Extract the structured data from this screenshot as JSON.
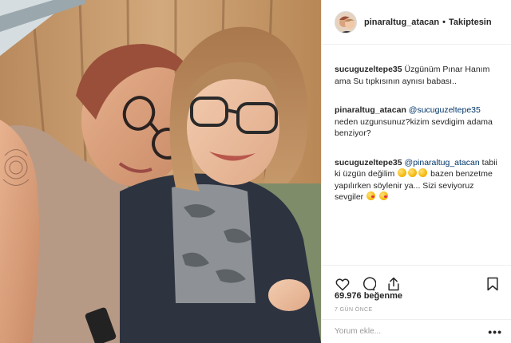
{
  "post": {
    "username": "pinaraltug_atacan",
    "follow_status": "Takiptesin",
    "separator": "•"
  },
  "comments": [
    {
      "user": "sucuguzeltepe35",
      "text": "Üzgünüm Pınar Hanım ama Su tıpkısının aynısı babası.."
    },
    {
      "user": "pinaraltug_atacan",
      "mention": "@sucuguzeltepe35",
      "text": "neden uzgunsunuz?kizim sevdigim adama benziyor?"
    },
    {
      "user": "sucuguzeltepe35",
      "mention": "@pinaraltug_atacan",
      "text_part1": "tabii ki üzgün değilim",
      "text_part2": "bazen benzetme yapılırken söylenir ya... Sizi seviyoruz sevgiler"
    }
  ],
  "actions": {
    "like_icon": "heart-icon",
    "comment_icon": "comment-icon",
    "share_icon": "share-icon",
    "save_icon": "bookmark-icon"
  },
  "likes": "69.976 beğenme",
  "time_ago": "7 GÜN ÖNCE",
  "comment_input": {
    "placeholder": "Yorum ekle..."
  },
  "more_options": "•••",
  "colors": {
    "text": "#262626",
    "mention": "#003569",
    "muted": "#999999",
    "border": "#efefef"
  }
}
